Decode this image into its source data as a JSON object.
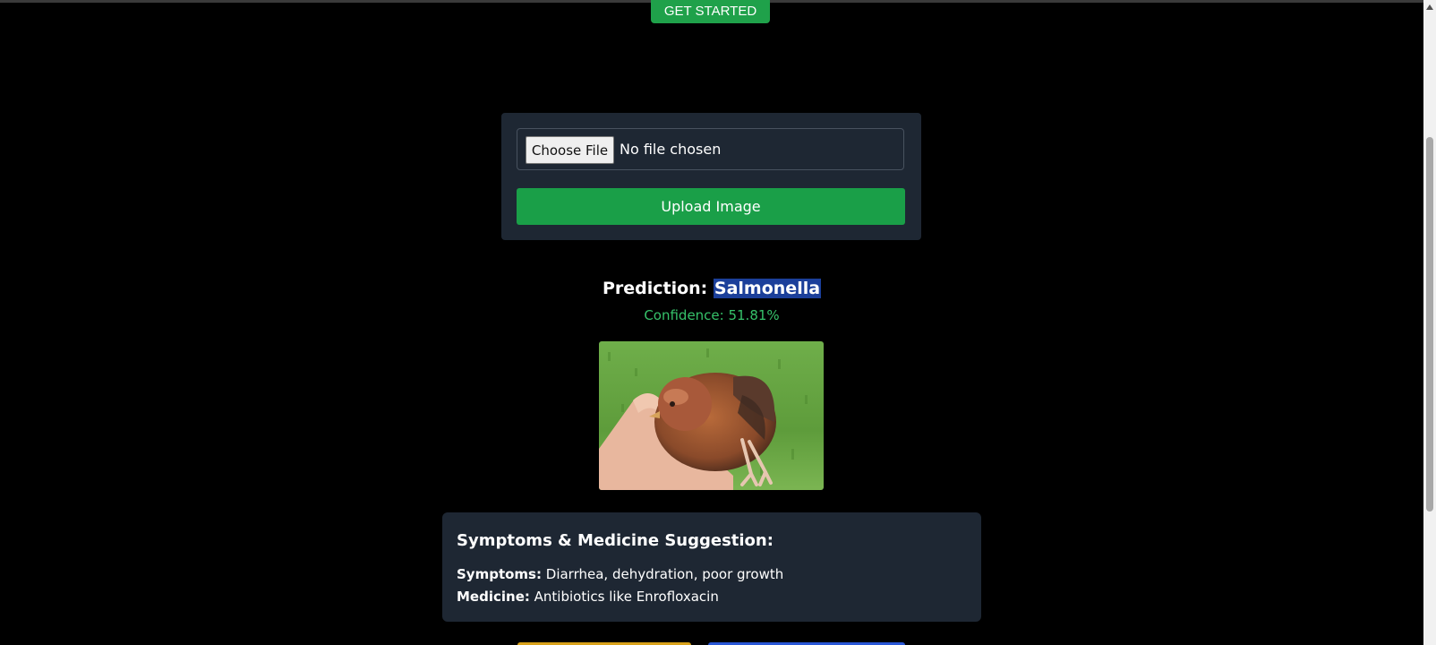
{
  "header": {
    "cta_label": "GET STARTED"
  },
  "upload": {
    "choose_file_label": "Choose File",
    "file_status": "No file chosen",
    "upload_button_label": "Upload Image"
  },
  "result": {
    "prediction_label": "Prediction:",
    "prediction_value": "Salmonella",
    "confidence_text": "Confidence: 51.81%",
    "image_subject": "chick-in-hand"
  },
  "suggestion": {
    "title": "Symptoms & Medicine Suggestion:",
    "symptoms_label": "Symptoms:",
    "symptoms_value": "Diarrhea, dehydration, poor growth",
    "medicine_label": "Medicine:",
    "medicine_value": "Antibiotics like Enrofloxacin"
  },
  "colors": {
    "background": "#000000",
    "card": "#1e2733",
    "primary_green": "#1a9f48",
    "confidence_green": "#36c26a",
    "selection_highlight": "#1b3f9a",
    "bottom_button_left": "#d9a21b",
    "bottom_button_right": "#2957d6"
  }
}
